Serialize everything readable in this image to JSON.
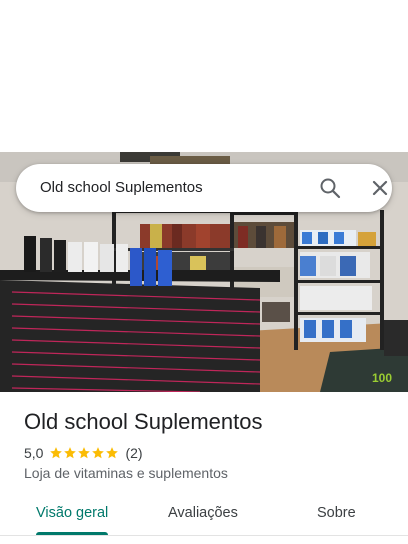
{
  "search": {
    "query": "Old school Suplementos"
  },
  "icons": {
    "search": "search-icon",
    "close": "close-icon",
    "star": "star-icon"
  },
  "place": {
    "name": "Old school Suplementos",
    "rating_value": "5,0",
    "rating_stars": 5,
    "review_count": "(2)",
    "category": "Loja de vitaminas e suplementos",
    "photo_description_icon": "store-photo"
  },
  "tabs": [
    {
      "label": "Visão geral",
      "active": true
    },
    {
      "label": "Avaliações",
      "active": false
    },
    {
      "label": "Sobre",
      "active": false
    }
  ],
  "colors": {
    "accent": "#00796b",
    "star": "#fbbc04"
  }
}
